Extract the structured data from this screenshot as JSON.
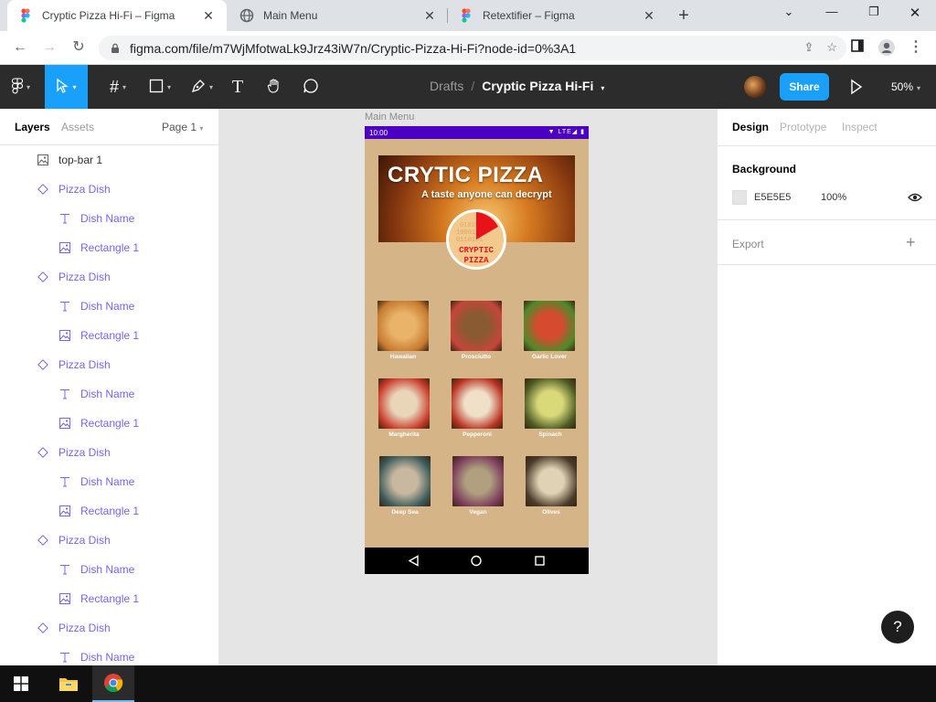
{
  "browser": {
    "tabs": [
      {
        "title": "Cryptic Pizza Hi-Fi – Figma",
        "active": true
      },
      {
        "title": "Main Menu",
        "active": false
      },
      {
        "title": "Retextifier – Figma",
        "active": false
      }
    ],
    "url": "figma.com/file/m7WjMfotwaLk9Jrz43iW7n/Cryptic-Pizza-Hi-Fi?node-id=0%3A1"
  },
  "figma": {
    "breadcrumb_drafts": "Drafts",
    "breadcrumb_separator": "/",
    "file_name": "Cryptic Pizza Hi-Fi",
    "share_label": "Share",
    "zoom": "50%"
  },
  "left_panel": {
    "tab_layers": "Layers",
    "tab_assets": "Assets",
    "page_selector": "Page 1",
    "layers": [
      {
        "name": "top-bar 1",
        "type": "image",
        "indent": 0
      },
      {
        "name": "Pizza Dish",
        "type": "component",
        "indent": 0
      },
      {
        "name": "Dish Name",
        "type": "text",
        "indent": 1
      },
      {
        "name": "Rectangle 1",
        "type": "image",
        "indent": 1
      },
      {
        "name": "Pizza Dish",
        "type": "component",
        "indent": 0
      },
      {
        "name": "Dish Name",
        "type": "text",
        "indent": 1
      },
      {
        "name": "Rectangle 1",
        "type": "image",
        "indent": 1
      },
      {
        "name": "Pizza Dish",
        "type": "component",
        "indent": 0
      },
      {
        "name": "Dish Name",
        "type": "text",
        "indent": 1
      },
      {
        "name": "Rectangle 1",
        "type": "image",
        "indent": 1
      },
      {
        "name": "Pizza Dish",
        "type": "component",
        "indent": 0
      },
      {
        "name": "Dish Name",
        "type": "text",
        "indent": 1
      },
      {
        "name": "Rectangle 1",
        "type": "image",
        "indent": 1
      },
      {
        "name": "Pizza Dish",
        "type": "component",
        "indent": 0
      },
      {
        "name": "Dish Name",
        "type": "text",
        "indent": 1
      },
      {
        "name": "Rectangle 1",
        "type": "image",
        "indent": 1
      },
      {
        "name": "Pizza Dish",
        "type": "component",
        "indent": 0
      },
      {
        "name": "Dish Name",
        "type": "text",
        "indent": 1
      }
    ]
  },
  "canvas": {
    "frame_label": "Main Menu",
    "status_time": "10:00",
    "status_right": "LTE",
    "banner_title": "CRYTIC PIZZA",
    "banner_subtitle": "A taste anyone can decrypt",
    "logo_text_1": "CRYPTIC",
    "logo_text_2": "PIZZA",
    "dishes": [
      {
        "name": "Hawaiian",
        "colors": [
          "#e9b46a",
          "#c77a2e"
        ]
      },
      {
        "name": "Prosciutto",
        "colors": [
          "#8a5a32",
          "#c6453a"
        ]
      },
      {
        "name": "Garlic Lover",
        "colors": [
          "#d64b2f",
          "#4f8a2a"
        ]
      },
      {
        "name": "Margherita",
        "colors": [
          "#e9d6b8",
          "#c83a2b"
        ]
      },
      {
        "name": "Pepperoni",
        "colors": [
          "#f0e0c8",
          "#b83322"
        ]
      },
      {
        "name": "Spinach",
        "colors": [
          "#d9d97a",
          "#4c5a22"
        ]
      },
      {
        "name": "Deep Sea",
        "colors": [
          "#c8b8a0",
          "#3a5a5a"
        ]
      },
      {
        "name": "Vegan",
        "colors": [
          "#b0a080",
          "#7a3b5a"
        ]
      },
      {
        "name": "Olives",
        "colors": [
          "#e0d2b4",
          "#4a3a2a"
        ]
      }
    ]
  },
  "right_panel": {
    "tab_design": "Design",
    "tab_prototype": "Prototype",
    "tab_inspect": "Inspect",
    "background_title": "Background",
    "background_hex": "E5E5E5",
    "background_opacity": "100%",
    "export_title": "Export",
    "help": "?"
  },
  "colors": {
    "figma_blue": "#18a0fb",
    "component_purple": "#7b61ff",
    "statusbar_purple": "#4c00c4",
    "phone_bg": "#d5b488"
  }
}
